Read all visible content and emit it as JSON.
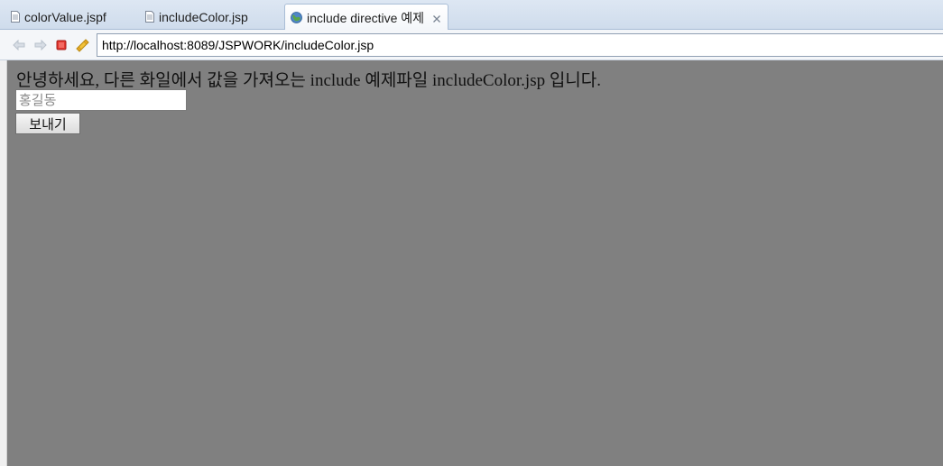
{
  "tabs": [
    {
      "label": "colorValue.jspf",
      "icon": "file-icon",
      "active": false
    },
    {
      "label": "includeColor.jsp",
      "icon": "file-icon",
      "active": false
    },
    {
      "label": "include directive 예제",
      "icon": "globe-icon",
      "active": true
    }
  ],
  "toolbar": {
    "back_icon": "arrow-left-icon",
    "forward_icon": "arrow-right-icon",
    "stop_icon": "stop-icon",
    "refresh_icon": "refresh-icon",
    "url": "http://localhost:8089/JSPWORK/includeColor.jsp"
  },
  "page": {
    "background_color": "#808080",
    "greeting": "안녕하세요, 다른 화일에서 값을 가져오는 include 예제파일 includeColor.jsp 입니다.",
    "name_input": {
      "value": "",
      "placeholder": "홍길동"
    },
    "send_button_label": "보내기"
  }
}
